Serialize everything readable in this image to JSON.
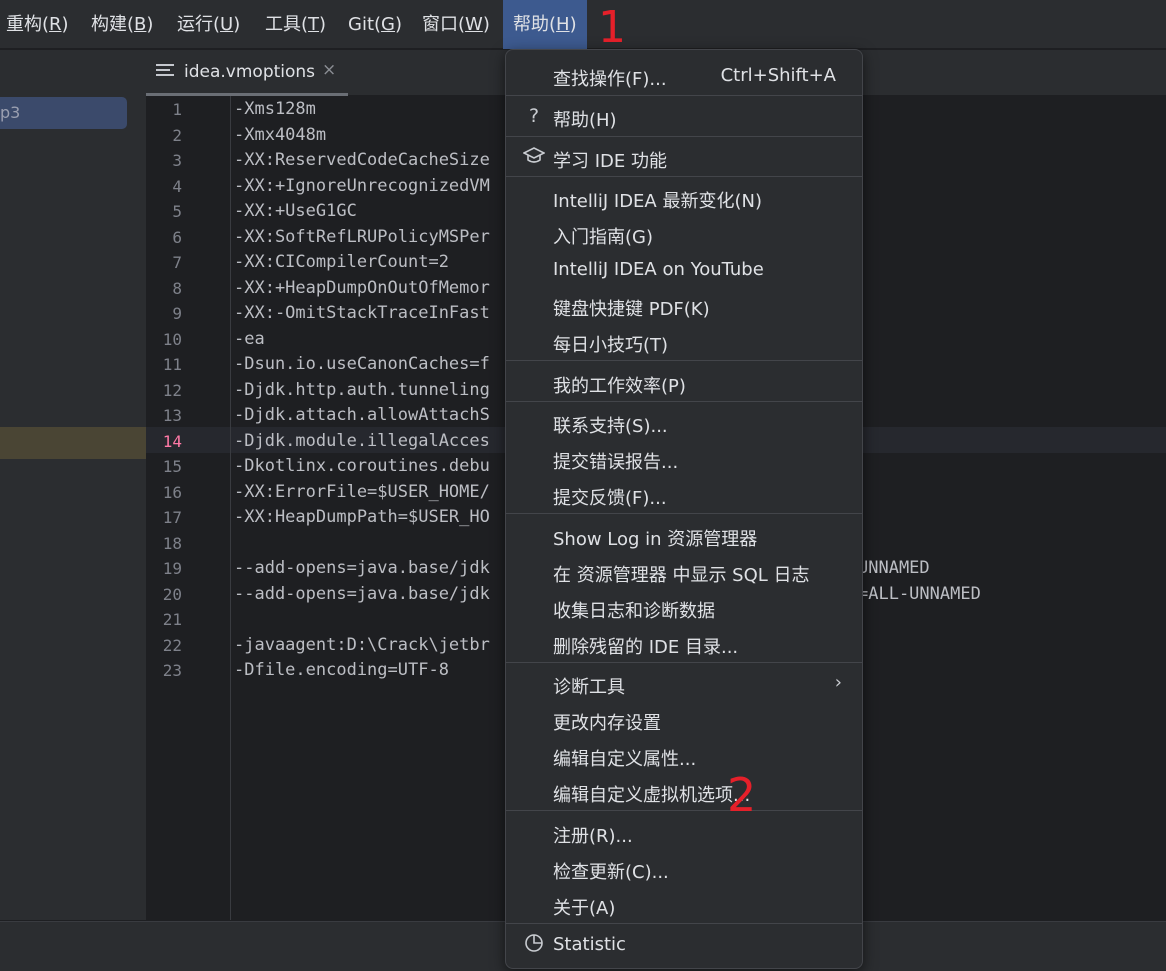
{
  "menubar": {
    "items": [
      {
        "text": "重构",
        "mnemonic": "R"
      },
      {
        "text": "构建",
        "mnemonic": "B"
      },
      {
        "text": "运行",
        "mnemonic": "U"
      },
      {
        "text": "工具",
        "mnemonic": "T"
      },
      {
        "text": "Git",
        "mnemonic": "G"
      },
      {
        "text": "窗口",
        "mnemonic": "W"
      },
      {
        "text": "帮助",
        "mnemonic": "H"
      }
    ],
    "paren_open": "(",
    "paren_close": ")",
    "active_index": 6
  },
  "annotations": {
    "one": "1",
    "two": "2"
  },
  "project": {
    "selected_fragment": "p3"
  },
  "tab": {
    "filename": "idea.vmoptions",
    "close_glyph": "×"
  },
  "editor": {
    "current_line": 14,
    "lines": [
      {
        "n": "1",
        "code": "-Xms128m"
      },
      {
        "n": "2",
        "code": "-Xmx4048m"
      },
      {
        "n": "3",
        "code": "-XX:ReservedCodeCacheSize"
      },
      {
        "n": "4",
        "code": "-XX:+IgnoreUnrecognizedVM"
      },
      {
        "n": "5",
        "code": "-XX:+UseG1GC"
      },
      {
        "n": "6",
        "code": "-XX:SoftRefLRUPolicyMSPer"
      },
      {
        "n": "7",
        "code": "-XX:CICompilerCount=2"
      },
      {
        "n": "8",
        "code": "-XX:+HeapDumpOnOutOfMemor"
      },
      {
        "n": "9",
        "code": "-XX:-OmitStackTraceInFast"
      },
      {
        "n": "10",
        "code": "-ea"
      },
      {
        "n": "11",
        "code": "-Dsun.io.useCanonCaches=f"
      },
      {
        "n": "12",
        "code": "-Djdk.http.auth.tunneling"
      },
      {
        "n": "13",
        "code": "-Djdk.attach.allowAttachS"
      },
      {
        "n": "14",
        "code": "-Djdk.module.illegalAcces"
      },
      {
        "n": "15",
        "code": "-Dkotlinx.coroutines.debu"
      },
      {
        "n": "16",
        "code": "-XX:ErrorFile=$USER_HOME/"
      },
      {
        "n": "17",
        "code": "-XX:HeapDumpPath=$USER_HO"
      },
      {
        "n": "18",
        "code": ""
      },
      {
        "n": "19",
        "code": "--add-opens=java.base/jdk"
      },
      {
        "n": "20",
        "code": "--add-opens=java.base/jdk"
      },
      {
        "n": "21",
        "code": ""
      },
      {
        "n": "22",
        "code": "-javaagent:D:\\Crack\\jetbr"
      },
      {
        "n": "23",
        "code": "-Dfile.encoding=UTF-8"
      }
    ],
    "tails": [
      {
        "line": 19,
        "text": "UNNAMED"
      },
      {
        "line": 20,
        "text": "=ALL-UNNAMED"
      }
    ]
  },
  "help_menu": {
    "find_action": {
      "label": "查找操作(F)...",
      "shortcut": "Ctrl+Shift+A"
    },
    "help": {
      "label": "帮助(H)",
      "icon": "question-icon",
      "glyph": "?"
    },
    "learn": {
      "label": "学习 IDE 功能",
      "icon": "graduation-cap-icon"
    },
    "whats_new": {
      "label": "IntelliJ IDEA 最新变化(N)"
    },
    "getting_started": {
      "label": "入门指南(G)"
    },
    "youtube": {
      "label": "IntelliJ IDEA on YouTube"
    },
    "keymap_pdf": {
      "label": "键盘快捷键 PDF(K)"
    },
    "tip_of_day": {
      "label": "每日小技巧(T)"
    },
    "productivity": {
      "label": "我的工作效率(P)"
    },
    "contact_support": {
      "label": "联系支持(S)..."
    },
    "submit_bug": {
      "label": "提交错误报告..."
    },
    "submit_feedback": {
      "label": "提交反馈(F)..."
    },
    "show_log": {
      "label": "Show Log in 资源管理器"
    },
    "show_sql_log": {
      "label": "在 资源管理器 中显示 SQL 日志"
    },
    "collect_logs": {
      "label": "收集日志和诊断数据"
    },
    "delete_leftover": {
      "label": "删除残留的 IDE 目录..."
    },
    "diagnostic_tools": {
      "label": "诊断工具",
      "arrow": "›"
    },
    "change_memory": {
      "label": "更改内存设置"
    },
    "edit_properties": {
      "label": "编辑自定义属性..."
    },
    "edit_vm_options": {
      "label": "编辑自定义虚拟机选项..."
    },
    "register": {
      "label": "注册(R)..."
    },
    "check_updates": {
      "label": "检查更新(C)..."
    },
    "about": {
      "label": "关于(A)"
    },
    "statistic": {
      "label": "Statistic",
      "icon": "pie-chart-icon"
    }
  },
  "colors": {
    "accent": "#3d5a8f",
    "annotation": "#e5202a",
    "current_line_number": "#ff79a6"
  }
}
